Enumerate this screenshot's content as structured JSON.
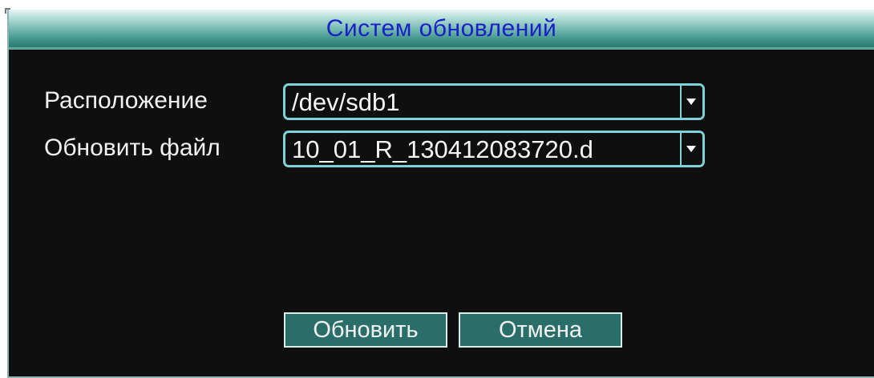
{
  "dialog": {
    "title": "Систем обновлений"
  },
  "form": {
    "location_label": "Расположение",
    "location_value": "/dev/sdb1",
    "update_file_label": "Обновить файл",
    "update_file_value": "10_01_R_130412083720.d"
  },
  "buttons": {
    "update_label": "Обновить",
    "cancel_label": "Отмена"
  },
  "colors": {
    "title_text": "#1a20c8",
    "dialog_background": "#0f0f0f",
    "field_border": "#7fd2d8",
    "button_background": "#2a6e6a"
  },
  "icons": {
    "dropdown": "chevron-down-icon"
  }
}
